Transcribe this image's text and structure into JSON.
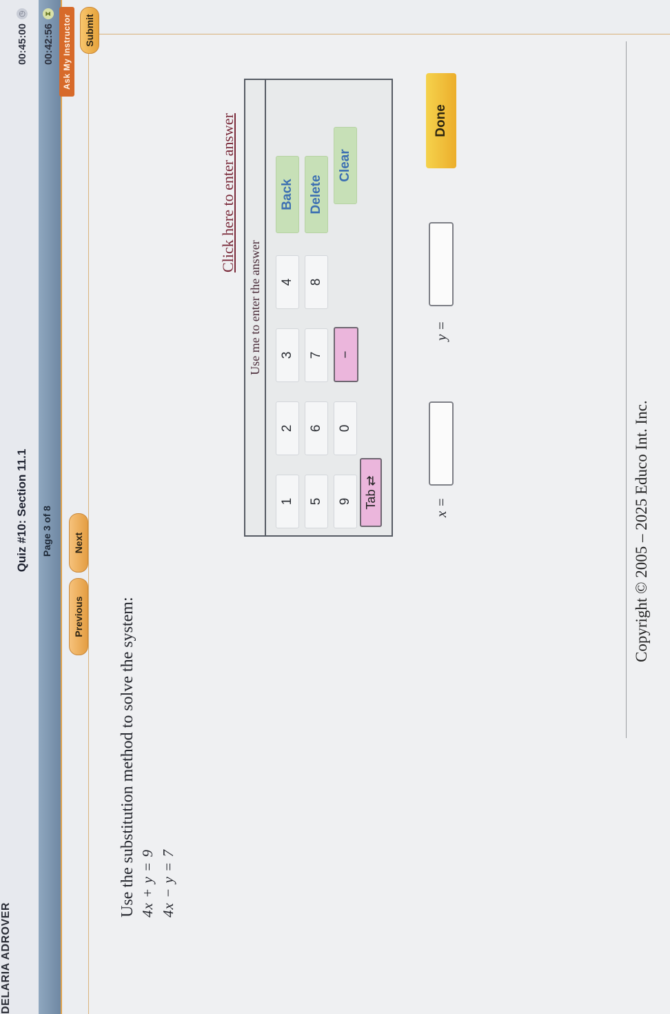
{
  "header": {
    "student_name": "DELARIA ADROVER",
    "quiz_title": "Quiz #10: Section 11.1",
    "timer_total": "00:45:00",
    "timer_remaining": "00:42:56",
    "page_label": "Page 3 of 8",
    "ask_label": "Ask My Instructor"
  },
  "nav": {
    "previous_label": "Previous",
    "next_label": "Next",
    "submit_label": "Submit"
  },
  "question": {
    "prompt": "Use the substitution method to solve the system:",
    "equation1": "4x + y = 9",
    "equation2": "4x − y = 7"
  },
  "keypad": {
    "link_text": "Click here to enter answer",
    "header": "Use me to enter the answer",
    "keys": [
      "1",
      "2",
      "3",
      "4",
      "5",
      "6",
      "7",
      "8",
      "9",
      "0",
      "−"
    ],
    "back_label": "Back",
    "delete_label": "Delete",
    "clear_label": "Clear",
    "tab_label": "Tab ⇄"
  },
  "answer": {
    "x_label": "x =",
    "y_label": "y =",
    "done_label": "Done"
  },
  "footer": {
    "copyright": "Copyright © 2005 – 2025 Educo Int. Inc."
  },
  "icons": {
    "timer_total": "clock-icon",
    "timer_remaining": "hourglass-icon"
  }
}
